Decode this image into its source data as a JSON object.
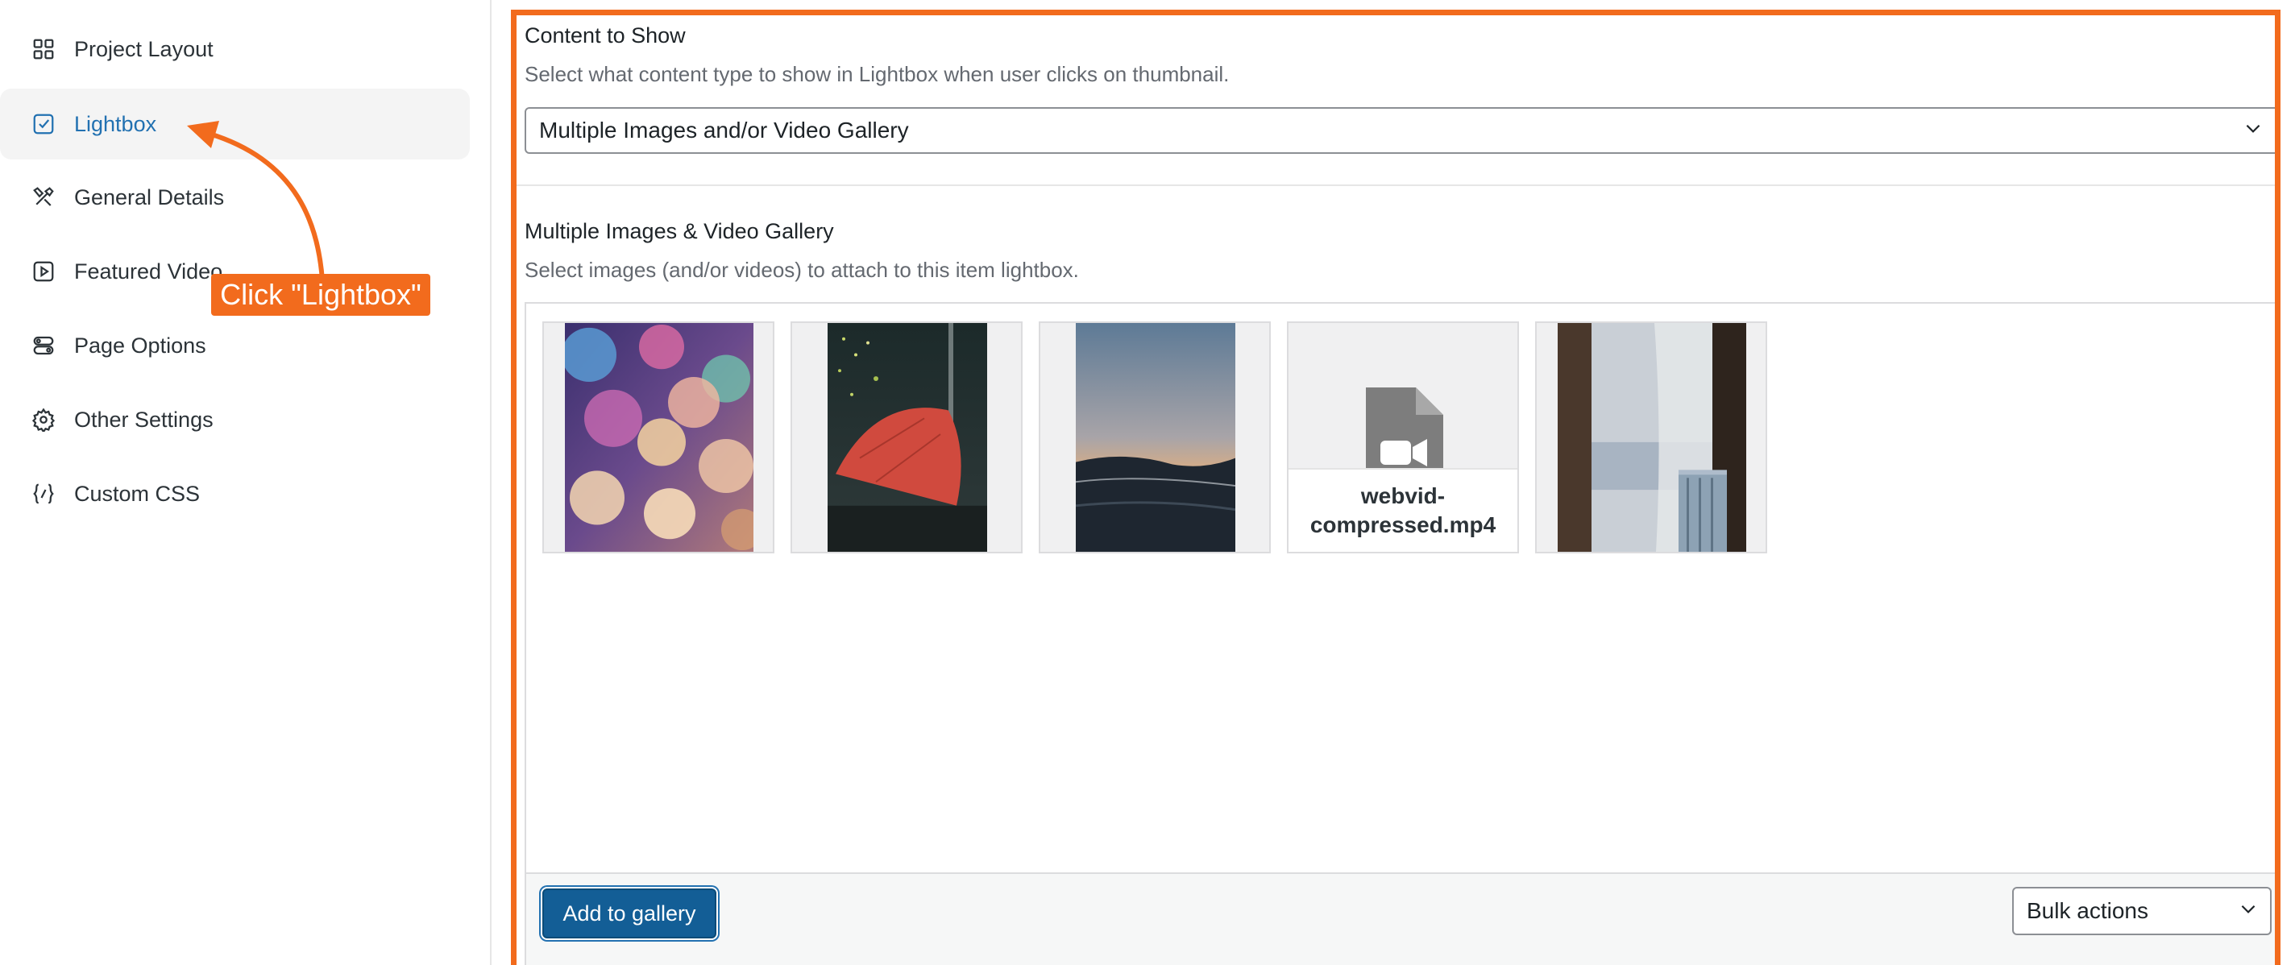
{
  "sidebar": {
    "items": [
      {
        "label": "Project Layout",
        "icon": "grid-icon",
        "active": false
      },
      {
        "label": "Lightbox",
        "icon": "checkbox-icon",
        "active": true
      },
      {
        "label": "General Details",
        "icon": "tools-icon",
        "active": false
      },
      {
        "label": "Featured Video",
        "icon": "play-square-icon",
        "active": false
      },
      {
        "label": "Page Options",
        "icon": "toggles-icon",
        "active": false
      },
      {
        "label": "Other Settings",
        "icon": "gear-icon",
        "active": false
      },
      {
        "label": "Custom CSS",
        "icon": "code-braces-icon",
        "active": false
      }
    ]
  },
  "main": {
    "content": {
      "title": "Content to Show",
      "description": "Select what content type to show in Lightbox when user clicks on thumbnail.",
      "selected": "Multiple Images and/or Video Gallery"
    },
    "gallery": {
      "title": "Multiple Images & Video Gallery",
      "description": "Select images (and/or videos) to attach to this item lightbox.",
      "items": [
        {
          "type": "image",
          "subject": "bokeh lights"
        },
        {
          "type": "image",
          "subject": "red umbrella"
        },
        {
          "type": "image",
          "subject": "ocean sunset"
        },
        {
          "type": "video",
          "filename": "webvid-compressed.mp4"
        },
        {
          "type": "image",
          "subject": "window curtain"
        }
      ],
      "add_button": "Add to gallery",
      "bulk_actions": "Bulk actions"
    }
  },
  "annotation": {
    "callout": "Click \"Lightbox\"",
    "color": "#f26b1d"
  },
  "colors": {
    "accent": "#2271b1",
    "button": "#135e96",
    "highlight": "#f26b1d"
  }
}
